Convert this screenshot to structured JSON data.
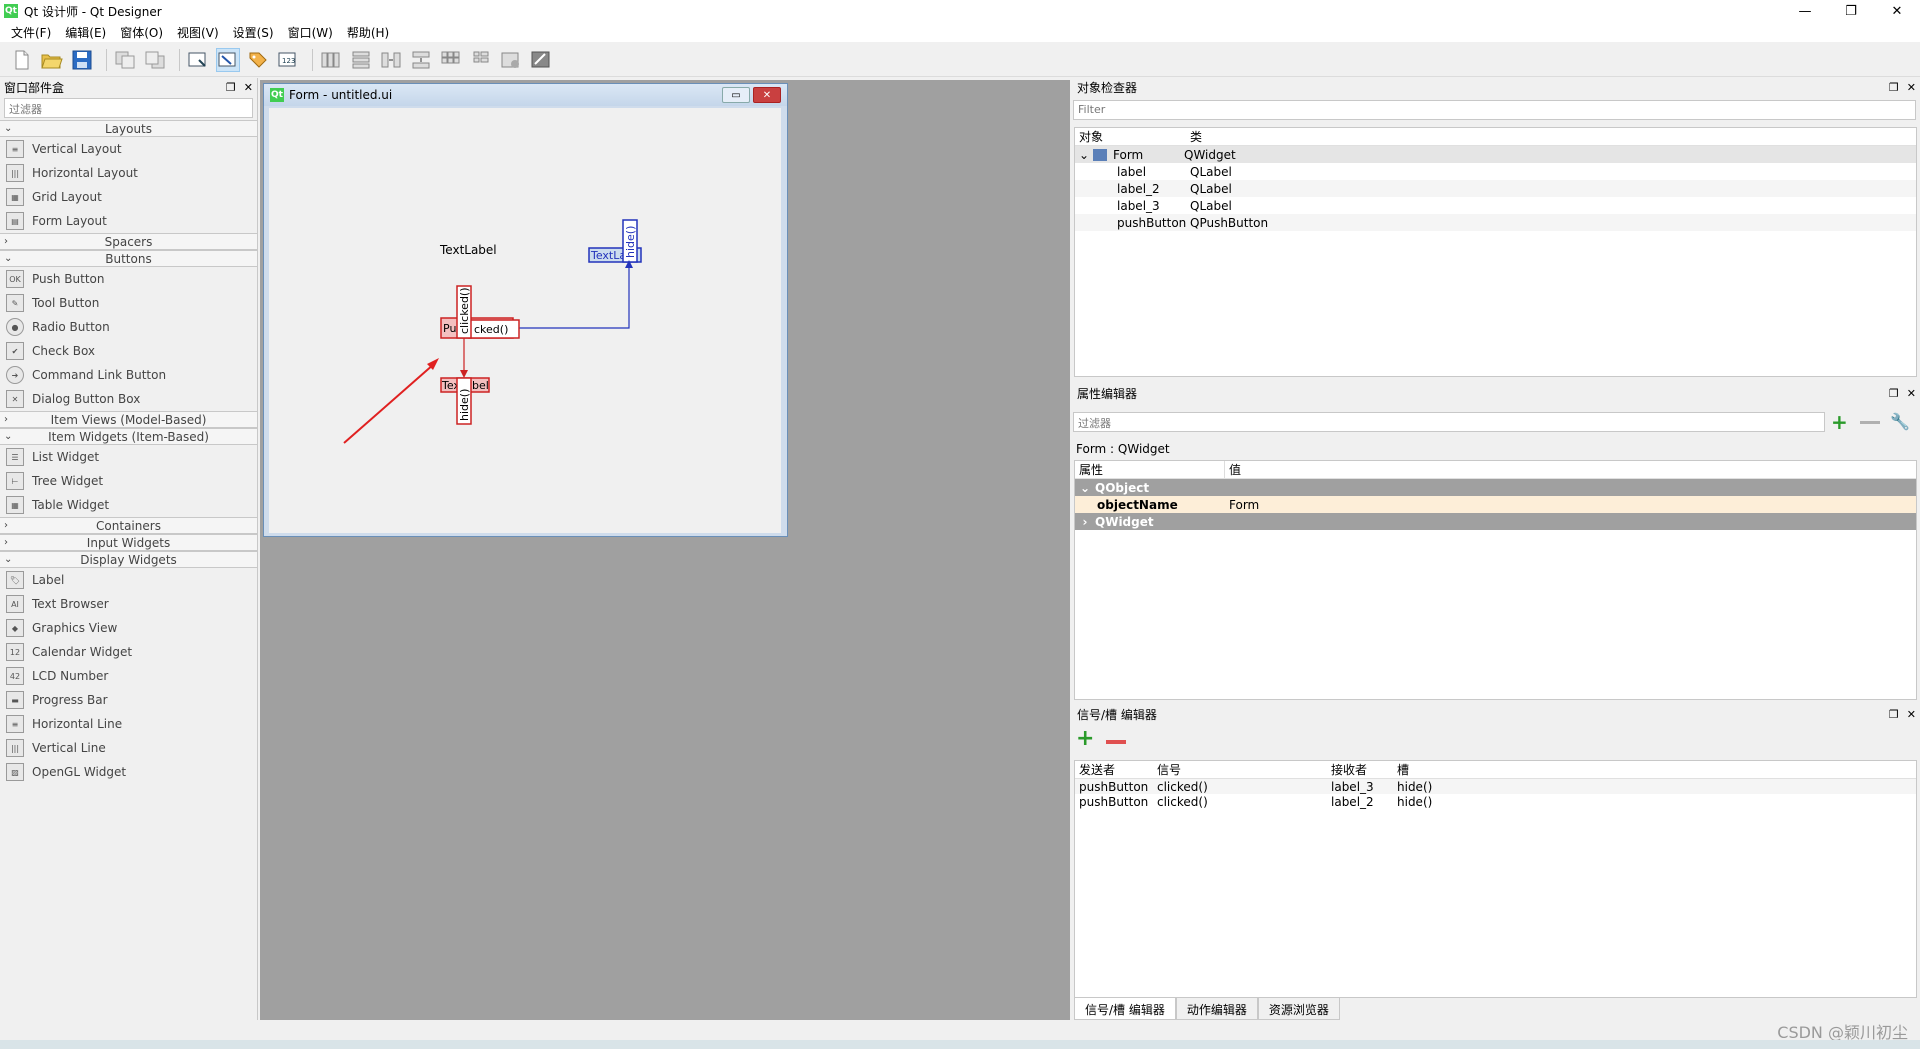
{
  "app": {
    "title": "Qt 设计师 - Qt Designer",
    "logo": "Qt"
  },
  "window_controls": [
    "—",
    "❐",
    "✕"
  ],
  "menu": [
    "文件(F)",
    "编辑(E)",
    "窗体(O)",
    "视图(V)",
    "设置(S)",
    "窗口(W)",
    "帮助(H)"
  ],
  "toolbar_icons": [
    "new-file-icon",
    "open-file-icon",
    "save-icon",
    "bring-front-icon",
    "send-back-icon",
    "edit-widgets-icon",
    "edit-signals-slots-icon",
    "edit-buddies-icon",
    "edit-tab-order-icon",
    "layout-horizontal-icon",
    "layout-vertical-icon",
    "layout-h-splitter-icon",
    "layout-v-splitter-icon",
    "layout-grid-icon",
    "layout-form-icon",
    "break-layout-icon",
    "adjust-size-icon"
  ],
  "widget_box": {
    "title": "窗口部件盒",
    "filter_placeholder": "过滤器",
    "cat_layouts": "Layouts",
    "layouts": [
      "Vertical Layout",
      "Horizontal Layout",
      "Grid Layout",
      "Form Layout"
    ],
    "cat_spacers": "Spacers",
    "cat_buttons": "Buttons",
    "buttons": [
      "Push Button",
      "Tool Button",
      "Radio Button",
      "Check Box",
      "Command Link Button",
      "Dialog Button Box"
    ],
    "cat_item_views": "Item Views (Model-Based)",
    "cat_item_widgets": "Item Widgets (Item-Based)",
    "item_widgets": [
      "List Widget",
      "Tree Widget",
      "Table Widget"
    ],
    "cat_containers": "Containers",
    "cat_input": "Input Widgets",
    "cat_display": "Display Widgets",
    "display_widgets": [
      "Label",
      "Text Browser",
      "Graphics View",
      "Calendar Widget",
      "LCD Number",
      "Progress Bar",
      "Horizontal Line",
      "Vertical Line",
      "OpenGL Widget"
    ]
  },
  "form": {
    "title": "Form - untitled.ui",
    "label_text": "TextLabel",
    "label2_text": "TextLa",
    "pushbutton_text": "Pu",
    "label3_text": "Tex",
    "label3_text_b": "bel",
    "clicked_text": "clicked()",
    "clicked_partial": "cked()",
    "hide_text": "hide()"
  },
  "object_inspector": {
    "title": "对象检查器",
    "filter_placeholder": "Filter",
    "col_object": "对象",
    "col_class": "类",
    "rows": [
      {
        "object": "Form",
        "class": "QWidget"
      },
      {
        "object": "label",
        "class": "QLabel"
      },
      {
        "object": "label_2",
        "class": "QLabel"
      },
      {
        "object": "label_3",
        "class": "QLabel"
      },
      {
        "object": "pushButton",
        "class": "QPushButton"
      }
    ]
  },
  "property_editor": {
    "title": "属性编辑器",
    "filter_placeholder": "过滤器",
    "context": "Form : QWidget",
    "col_property": "属性",
    "col_value": "值",
    "group_qobject": "QObject",
    "prop_name": "objectName",
    "prop_value": "Form",
    "group_qwidget": "QWidget"
  },
  "signal_slot_editor": {
    "title": "信号/槽 编辑器",
    "col_sender": "发送者",
    "col_signal": "信号",
    "col_receiver": "接收者",
    "col_slot": "槽",
    "rows": [
      {
        "sender": "pushButton",
        "signal": "clicked()",
        "receiver": "label_3",
        "slot": "hide()"
      },
      {
        "sender": "pushButton",
        "signal": "clicked()",
        "receiver": "label_2",
        "slot": "hide()"
      }
    ]
  },
  "bottom_tabs": [
    "信号/槽 编辑器",
    "动作编辑器",
    "资源浏览器"
  ],
  "watermark": "CSDN @颖川初尘"
}
